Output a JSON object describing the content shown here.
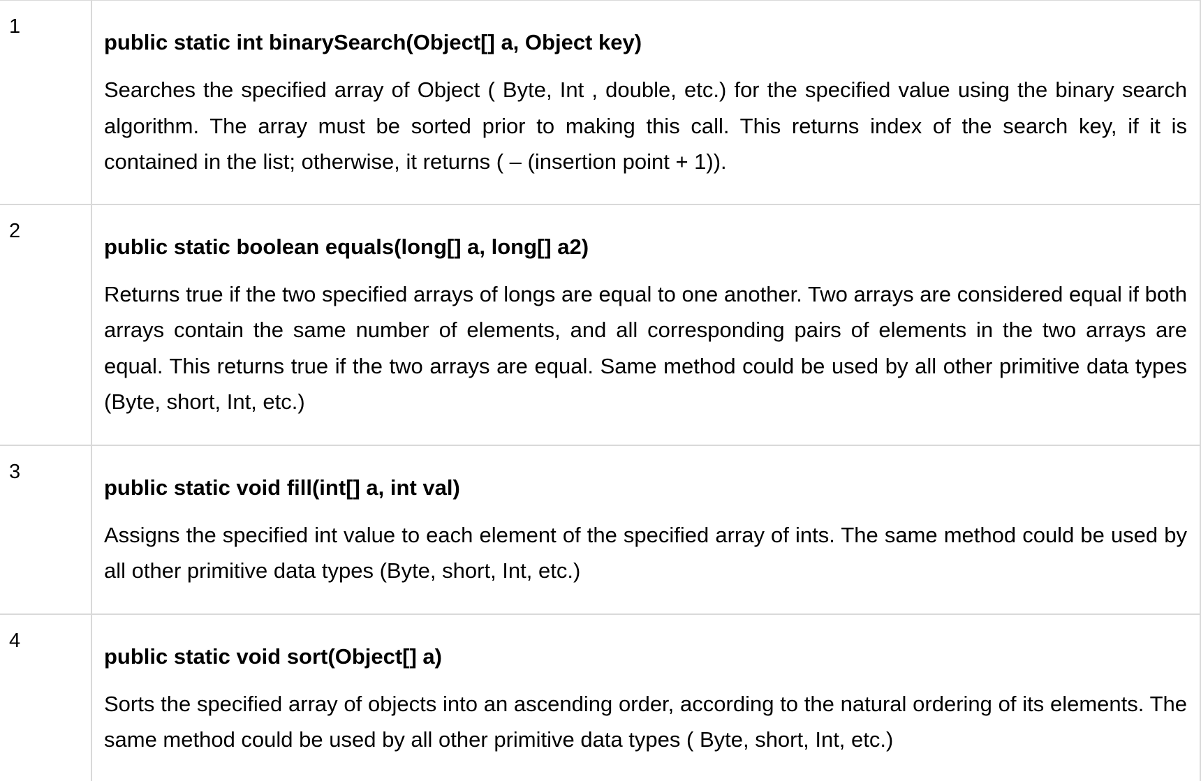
{
  "methods": [
    {
      "number": "1",
      "signature": "public static int binarySearch(Object[] a, Object key)",
      "description": "Searches the specified array of Object ( Byte, Int , double, etc.) for the specified value using the binary search algorithm. The array must be sorted prior to making this call. This returns index of the search key, if it is contained in the list; otherwise, it returns ( – (insertion point + 1))."
    },
    {
      "number": "2",
      "signature": "public static boolean equals(long[] a, long[] a2)",
      "description": "Returns true if the two specified arrays of longs are equal to one another. Two arrays are considered equal if both arrays contain the same number of elements, and all corresponding pairs of elements in the two arrays are equal. This returns true if the two arrays are equal. Same method could be used by all other primitive data types (Byte, short, Int, etc.)"
    },
    {
      "number": "3",
      "signature": "public static void fill(int[] a, int val)",
      "description": "Assigns the specified int value to each element of the specified array of ints. The same method could be used by all other primitive data types (Byte, short, Int, etc.)"
    },
    {
      "number": "4",
      "signature": "public static void sort(Object[] a)",
      "description": "Sorts the specified array of objects into an ascending order, according to the natural ordering of its elements. The same method could be used by all other primitive data types ( Byte, short, Int, etc.)"
    }
  ]
}
